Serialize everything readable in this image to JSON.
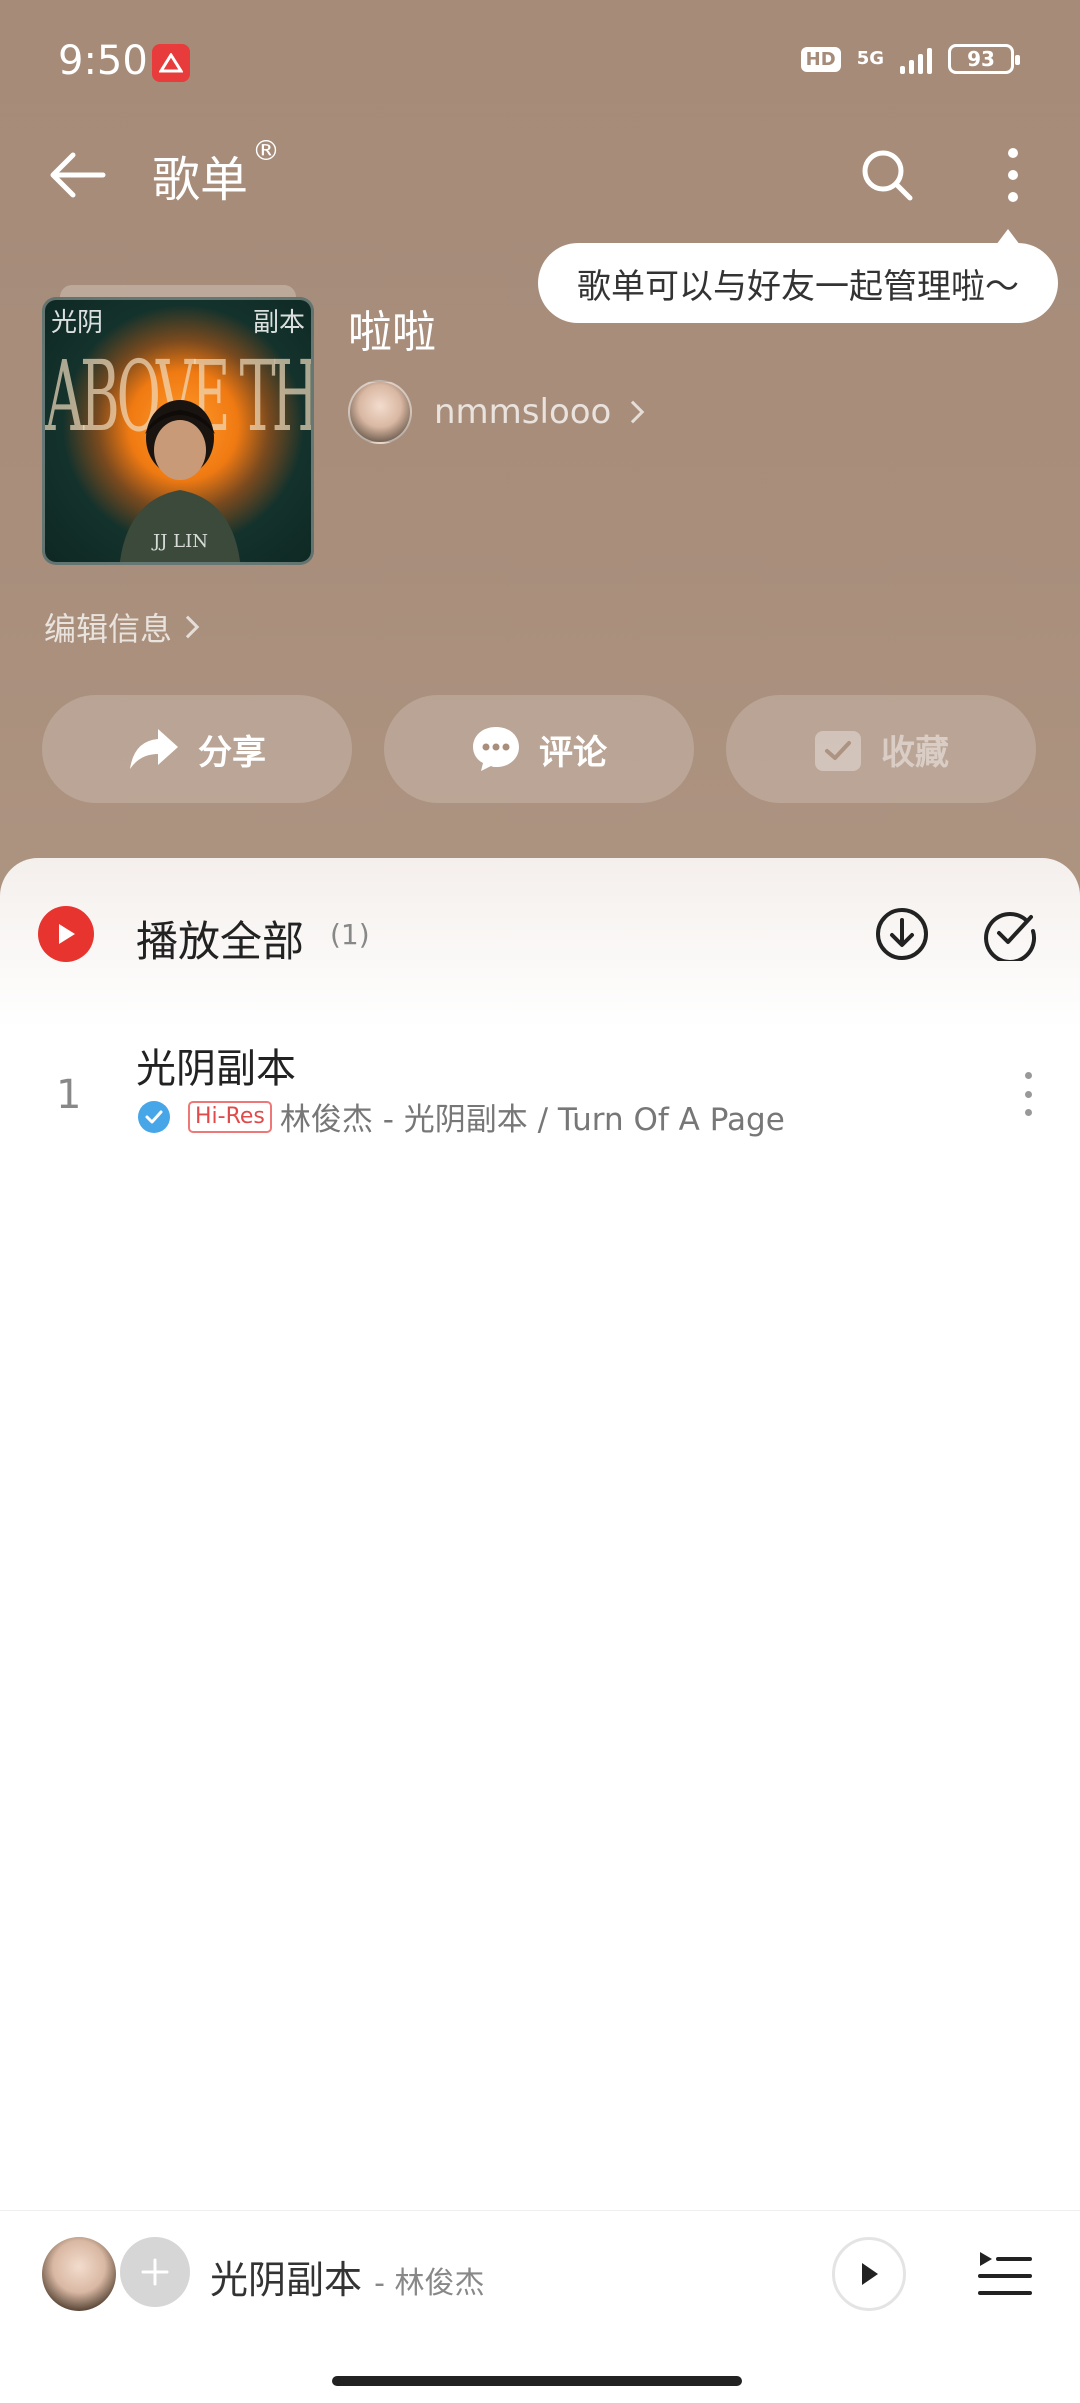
{
  "status_bar": {
    "time": "9:50",
    "network": "5G",
    "hd": "HD",
    "battery": "93"
  },
  "app_bar": {
    "title": "歌单",
    "title_mark": "®"
  },
  "tooltip": {
    "text": "歌单可以与好友一起管理啦～"
  },
  "playlist": {
    "name": "啦啦",
    "owner": "nmmslooo",
    "edit_label": "编辑信息",
    "cover": {
      "top_left": "光阴",
      "top_right": "副本",
      "band": "ABOVE THE FRAY",
      "bottom": "JJ LIN"
    }
  },
  "actions": {
    "share": "分享",
    "comment": "评论",
    "collect": "收藏"
  },
  "list": {
    "play_all_label": "播放全部",
    "count": "(1)",
    "songs": [
      {
        "index": "1",
        "title": "光阴副本",
        "quality": "Hi-Res",
        "subtitle": "林俊杰 - 光阴副本 / Turn Of A Page"
      }
    ]
  },
  "mini_player": {
    "title": "光阴副本",
    "artist": "- 林俊杰"
  },
  "colors": {
    "header_bg": "#a58b78",
    "accent_red": "#e8342f",
    "verified_blue": "#47a6e8"
  }
}
